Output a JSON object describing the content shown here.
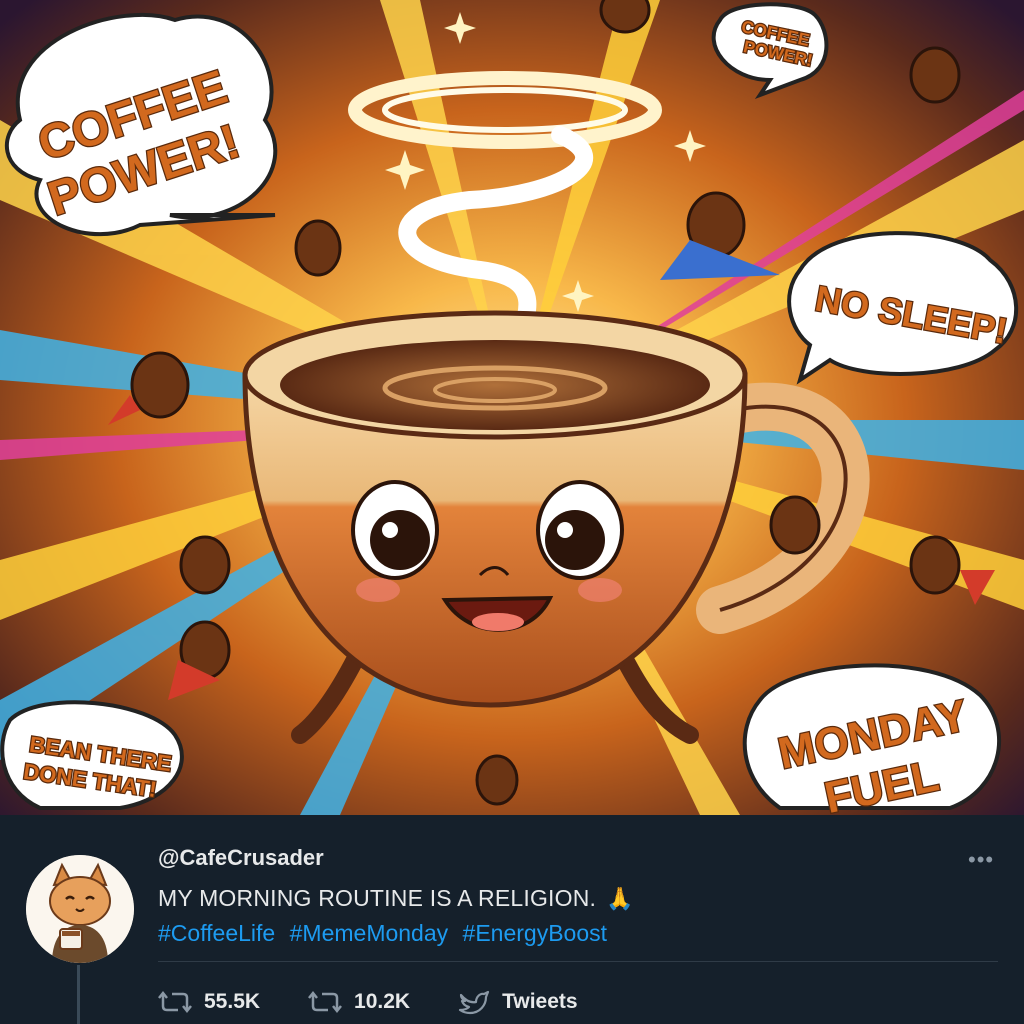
{
  "image": {
    "bubbles": {
      "coffee_power_big": [
        "COFFEE",
        "POWER!"
      ],
      "coffee_power_small": [
        "COFFEE",
        "POWER!"
      ],
      "no_sleep": "NO SLEEP!",
      "bean_there": [
        "BEAN THERE",
        "DONE THAT!"
      ],
      "monday_fuel": [
        "MONDAY",
        "FUEL"
      ]
    }
  },
  "tweet": {
    "handle": "@CafeCrusader",
    "text": "MY MORNING ROUTINE IS A RELIGION.",
    "emoji": "🙏",
    "hashtags": [
      "#CoffeeLife",
      "#MemeMonday",
      "#EnergyBoost"
    ],
    "more_icon": "•••",
    "actions": [
      {
        "icon": "retweet-icon",
        "label": "55.5K"
      },
      {
        "icon": "retweet-icon",
        "label": "10.2K"
      },
      {
        "icon": "bird-icon",
        "label": "Twieets"
      }
    ]
  },
  "colors": {
    "background": "#15202b",
    "text": "#e7e9ea",
    "link": "#1d9bf0",
    "muted": "#8b98a5",
    "bubble_text": "#d2691e"
  }
}
